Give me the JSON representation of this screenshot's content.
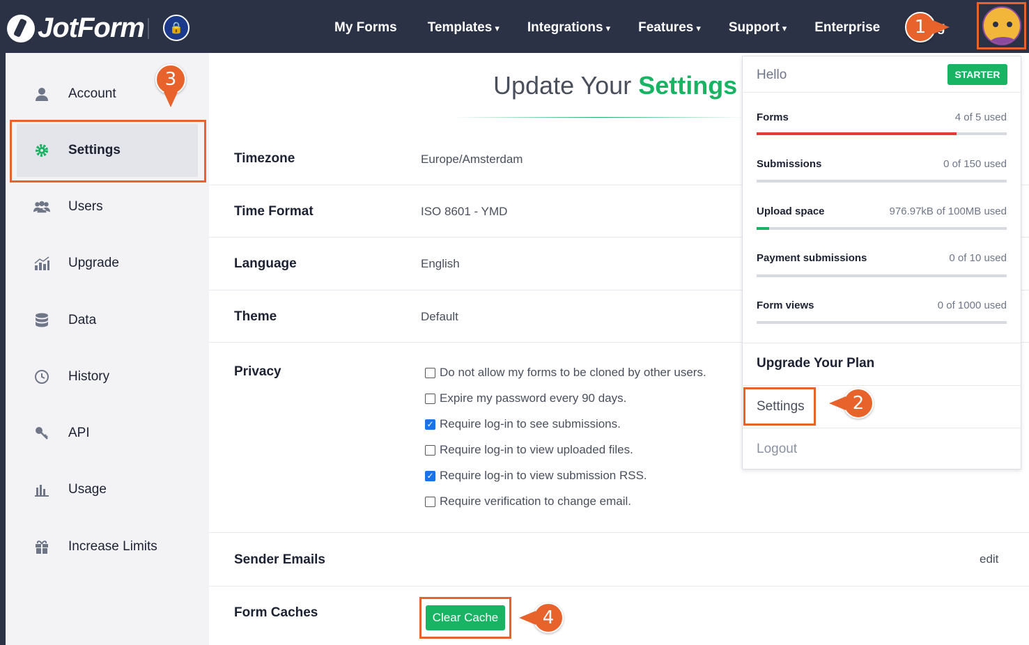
{
  "nav": {
    "logo_text": "JotForm",
    "items": [
      {
        "label": "My Forms",
        "caret": ""
      },
      {
        "label": "Templates",
        "caret": "▾"
      },
      {
        "label": "Integrations",
        "caret": "▾"
      },
      {
        "label": "Features",
        "caret": "▾"
      },
      {
        "label": "Support",
        "caret": "▾"
      },
      {
        "label": "Enterprise",
        "caret": ""
      }
    ],
    "tail_text": "g"
  },
  "sidebar": {
    "items": [
      {
        "label": "Account",
        "icon": "user-icon"
      },
      {
        "label": "Settings",
        "icon": "gear-icon"
      },
      {
        "label": "Users",
        "icon": "users-icon"
      },
      {
        "label": "Upgrade",
        "icon": "upgrade-chart-icon"
      },
      {
        "label": "Data",
        "icon": "database-icon"
      },
      {
        "label": "History",
        "icon": "history-icon"
      },
      {
        "label": "API",
        "icon": "key-icon"
      },
      {
        "label": "Usage",
        "icon": "bar-chart-icon"
      },
      {
        "label": "Increase Limits",
        "icon": "gift-icon"
      }
    ]
  },
  "main": {
    "title_prefix": "Update Your ",
    "title_accent": "Settings",
    "rows": {
      "timezone": {
        "label": "Timezone",
        "value": "Europe/Amsterdam"
      },
      "time_format": {
        "label": "Time Format",
        "value": "ISO 8601 - YMD"
      },
      "language": {
        "label": "Language",
        "value": "English"
      },
      "theme": {
        "label": "Theme",
        "value": "Default"
      },
      "privacy": {
        "label": "Privacy"
      },
      "sender_emails": {
        "label": "Sender Emails",
        "edit": "edit"
      },
      "form_caches": {
        "label": "Form Caches",
        "button": "Clear Cache"
      }
    },
    "privacy_options": [
      {
        "label": "Do not allow my forms to be cloned by other users.",
        "checked": false
      },
      {
        "label": "Expire my password every 90 days.",
        "checked": false
      },
      {
        "label": "Require log-in to see submissions.",
        "checked": true
      },
      {
        "label": "Require log-in to view uploaded files.",
        "checked": false
      },
      {
        "label": "Require log-in to view submission RSS.",
        "checked": true
      },
      {
        "label": "Require verification to change email.",
        "checked": false
      }
    ]
  },
  "dropdown": {
    "hello": "Hello",
    "plan_badge": "STARTER",
    "usage": [
      {
        "name": "Forms",
        "value": "4 of 5 used",
        "fraction": 0.8,
        "color": "#e53935"
      },
      {
        "name": "Submissions",
        "value": "0 of 150 used",
        "fraction": 0,
        "color": "#19b364"
      },
      {
        "name": "Upload space",
        "value": "976.97kB of 100MB used",
        "fraction": 0.05,
        "color": "#19b364"
      },
      {
        "name": "Payment submissions",
        "value": "0 of 10 used",
        "fraction": 0,
        "color": "#19b364"
      },
      {
        "name": "Form views",
        "value": "0 of 1000 used",
        "fraction": 0,
        "color": "#19b364"
      }
    ],
    "upgrade": "Upgrade Your Plan",
    "settings": "Settings",
    "logout": "Logout"
  },
  "markers": [
    "1",
    "2",
    "3",
    "4"
  ],
  "colors": {
    "accent_green": "#19b364",
    "callout_orange": "#e8622c",
    "nav_bg": "#2b3245"
  }
}
